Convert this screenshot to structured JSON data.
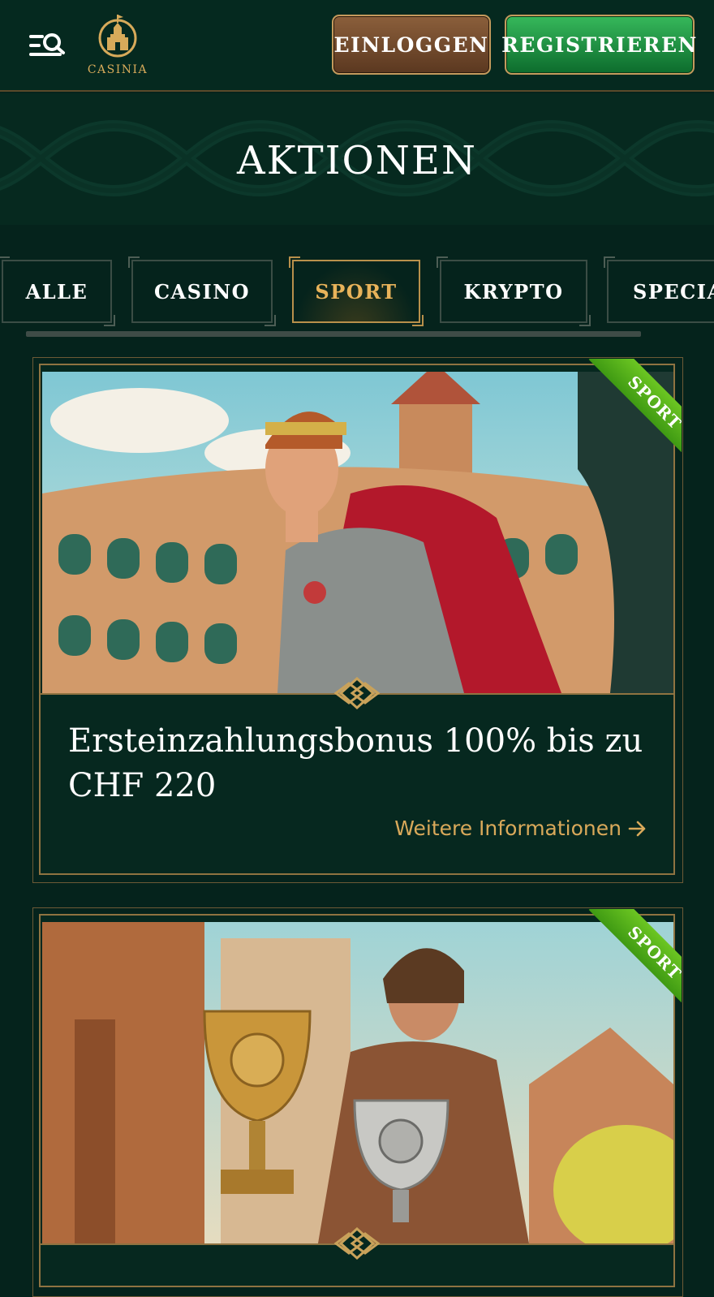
{
  "header": {
    "logo_text": "CASINIA",
    "login_label": "EINLOGGEN",
    "register_label": "REGISTRIEREN",
    "menu_icon": "menu-search-icon"
  },
  "hero": {
    "title": "AKTIONEN"
  },
  "tabs": [
    {
      "label": "ALLE",
      "active": false
    },
    {
      "label": "CASINO",
      "active": false
    },
    {
      "label": "SPORT",
      "active": true
    },
    {
      "label": "KRYPTO",
      "active": false
    },
    {
      "label": "SPECIA",
      "active": false
    }
  ],
  "promotions": [
    {
      "badge": "SPORT",
      "title": "Ersteinzahlungsbonus 100% bis zu CHF 220",
      "link_label": "Weitere Informationen",
      "image": "gladiator-athlete-arena-illustration"
    },
    {
      "badge": "SPORT",
      "image": "warrior-with-crypto-trophies-illustration"
    }
  ],
  "colors": {
    "background": "#05231c",
    "gold": "#d9a95a",
    "green_button": "#1f9a44",
    "brown_button": "#6e4628",
    "ribbon_green": "#5cb81d"
  }
}
